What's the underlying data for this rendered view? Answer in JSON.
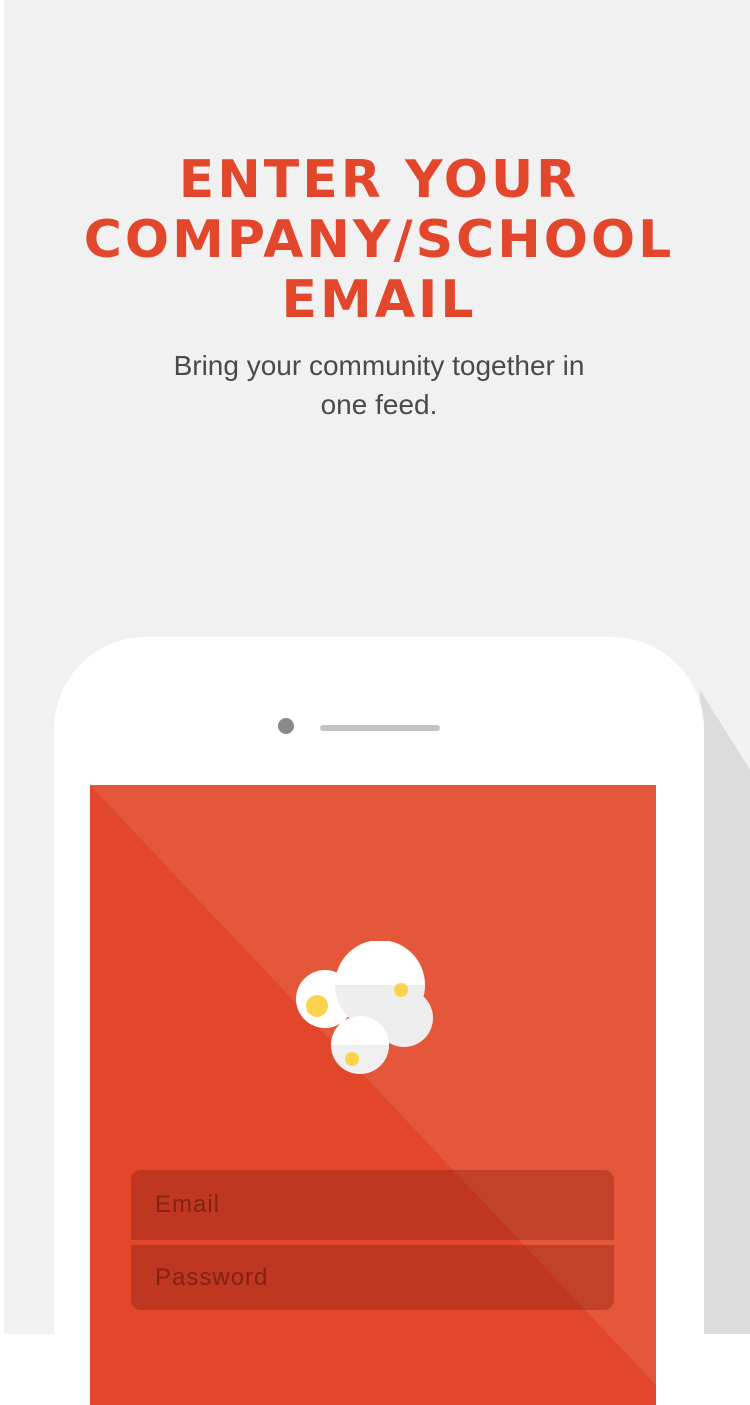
{
  "onboarding": {
    "headline_lines": [
      "ENTER YOUR",
      "COMPANY/SCHOOL",
      "EMAIL"
    ],
    "subtitle": "Bring your community together in one feed."
  },
  "login_form": {
    "email_placeholder": "Email",
    "password_placeholder": "Password"
  },
  "icons": {
    "phone_mockup": "phone-outline-icon",
    "app_logo": "popcorn-logo-icon"
  },
  "colors": {
    "brand_red": "#e2472c",
    "brand_red_light": "#e5573a",
    "background": "#f1f1f1",
    "logo_yellow": "#fdd34b"
  }
}
